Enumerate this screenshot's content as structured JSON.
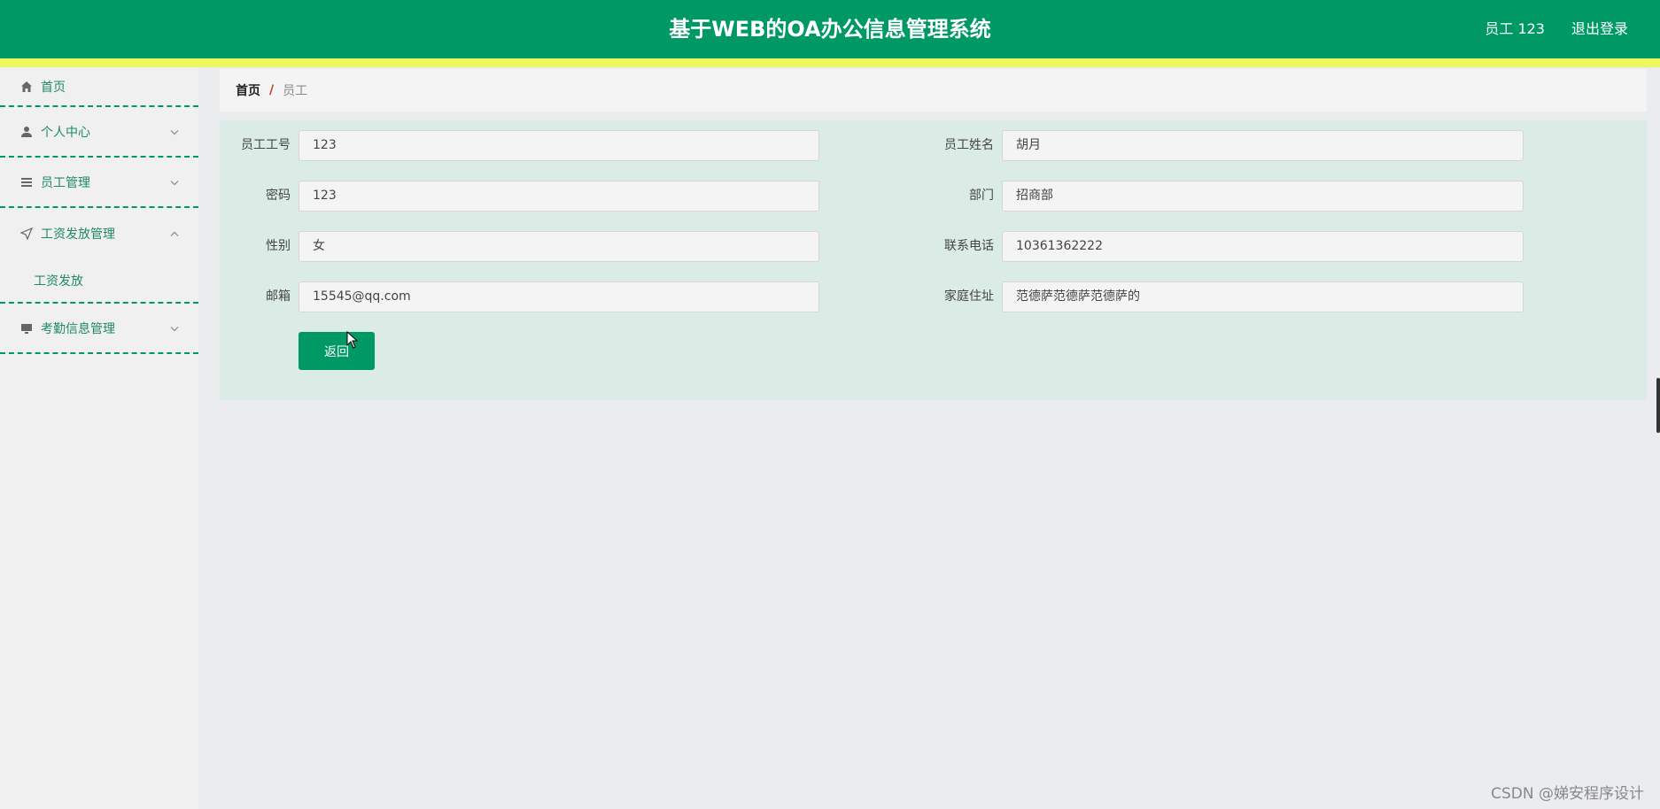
{
  "header": {
    "title": "基于WEB的OA办公信息管理系统",
    "user": "员工 123",
    "logout": "退出登录"
  },
  "sidebar": {
    "items": [
      {
        "label": "首页",
        "icon": "home-icon"
      },
      {
        "label": "个人中心",
        "icon": "user-icon"
      },
      {
        "label": "员工管理",
        "icon": "list-icon"
      },
      {
        "label": "工资发放管理",
        "icon": "send-icon",
        "expanded": true,
        "children": [
          "工资发放"
        ]
      },
      {
        "label": "考勤信息管理",
        "icon": "monitor-icon"
      }
    ]
  },
  "breadcrumb": {
    "home": "首页",
    "separator": "/",
    "current": "员工"
  },
  "form": {
    "employee_no": {
      "label": "员工工号",
      "value": "123"
    },
    "employee_name": {
      "label": "员工姓名",
      "value": "胡月"
    },
    "password": {
      "label": "密码",
      "value": "123"
    },
    "department": {
      "label": "部门",
      "value": "招商部"
    },
    "gender": {
      "label": "性别",
      "value": "女"
    },
    "phone": {
      "label": "联系电话",
      "value": "10361362222"
    },
    "email": {
      "label": "邮箱",
      "value": "15545@qq.com"
    },
    "address": {
      "label": "家庭住址",
      "value": "范德萨范德萨范德萨的"
    },
    "back_button": "返回"
  },
  "watermark": "CSDN @娣安程序设计",
  "colors": {
    "primary": "#009966",
    "stripe": "#eef760",
    "panel": "#dbebe6"
  }
}
